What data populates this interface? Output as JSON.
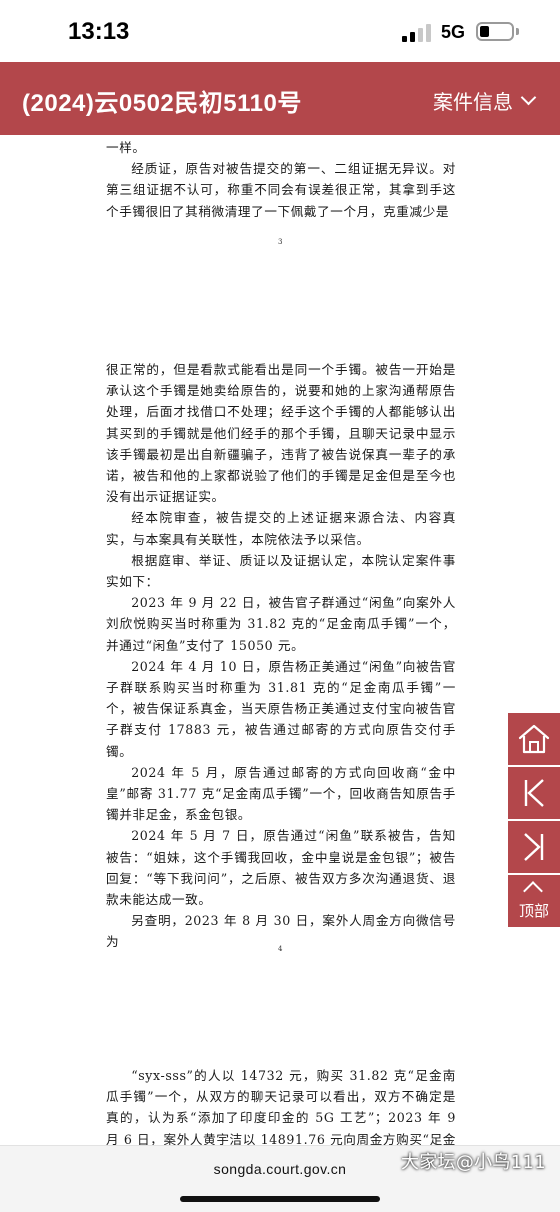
{
  "status_bar": {
    "time": "13:13",
    "network": "5G"
  },
  "header": {
    "case_title": "(2024)云0502民初5110号",
    "case_info_label": "案件信息"
  },
  "document": {
    "top_paragraphs": [
      "一样。",
      "经质证，原告对被告提交的第一、二组证据无异议。对第三组证据不认可，称重不同会有误差很正常，其拿到手这个手镯很旧了其稍微清理了一下佩戴了一个月，克重减少是"
    ],
    "page_number_1": "3",
    "middle_paragraphs": [
      "很正常的，但是看款式能看出是同一个手镯。被告一开始是承认这个手镯是她卖给原告的，说要和她的上家沟通帮原告处理，后面才找借口不处理；经手这个手镯的人都能够认出其买到的手镯就是他们经手的那个手镯，且聊天记录中显示该手镯最初是出自新疆骗子，违背了被告说保真一辈子的承诺，被告和他的上家都说验了他们的手镯是足金但是至今也没有出示证据证实。",
      "经本院审查，被告提交的上述证据来源合法、内容真实，与本案具有关联性，本院依法予以采信。",
      "根据庭审、举证、质证以及证据认定，本院认定案件事实如下：",
      "2023 年 9 月 22 日，被告官子群通过“闲鱼”向案外人刘欣悦购买当时称重为 31.82 克的“足金南瓜手镯”一个，并通过“闲鱼”支付了 15050 元。",
      "2024 年 4 月 10 日，原告杨正美通过“闲鱼”向被告官子群联系购买当时称重为 31.81 克的“足金南瓜手镯”一个，被告保证系真金，当天原告杨正美通过支付宝向被告官子群支付 17883 元，被告通过邮寄的方式向原告交付手镯。",
      "2024 年 5 月，原告通过邮寄的方式向回收商“金中皇”邮寄 31.77 克“足金南瓜手镯”一个，回收商告知原告手镯并非足金，系金包银。",
      "2024 年 5 月 7 日，原告通过“闲鱼”联系被告，告知被告：“姐妹，这个手镯我回收，金中皇说是金包银”；被告回复：“等下我问问”，之后原、被告双方多次沟通退货、退款未能达成一致。",
      "另查明，2023 年 8 月 30 日，案外人周金方向微信号为"
    ],
    "page_number_2": "4",
    "bottom_paragraphs": [
      "“syx-sss”的人以 14732 元，购买 31.82 克“足金南瓜手镯”一个，从双方的聊天记录可以看出，双方不确定是真的，认为系“添加了印度印金的 5G 工艺”；2023 年 9 月 6 日，案外人黄宇洁以 14891.76 元向周金方购买“足金南瓜手镯”："
    ]
  },
  "side_nav": {
    "top_label": "顶部"
  },
  "footer": {
    "url": "songda.court.gov.cn",
    "watermark": "大家坛@小鸟111"
  },
  "colors": {
    "brand": "#b3474b",
    "text": "#1a1a1a"
  }
}
